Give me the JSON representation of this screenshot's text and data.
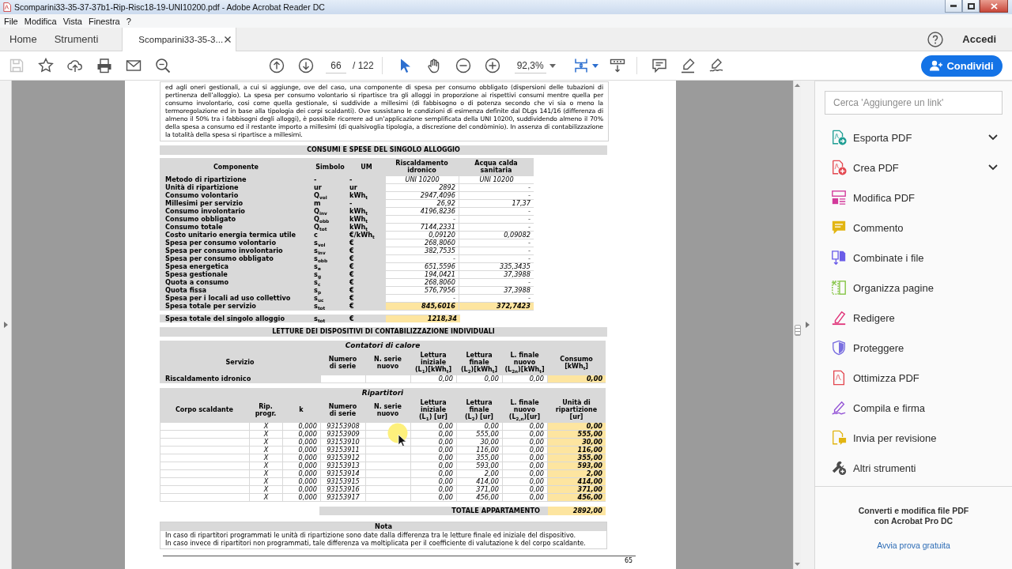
{
  "window": {
    "title": "Scomparini33-35-37-37b1-Rip-Risc18-19-UNI10200.pdf - Adobe Acrobat Reader DC"
  },
  "menu": [
    "File",
    "Modifica",
    "Vista",
    "Finestra",
    "?"
  ],
  "tabs": [
    {
      "kind": "nav",
      "label": "Home",
      "selected": false
    },
    {
      "kind": "nav",
      "label": "Strumenti",
      "selected": false
    },
    {
      "kind": "document",
      "label": "Scomparini33-35-3...",
      "selected": true
    }
  ],
  "account": {
    "label": "Accedi"
  },
  "toolbar": {
    "save": {
      "disabled": true
    },
    "page": "66",
    "page_total": "/ 122",
    "pointer_tools": [
      {
        "selected": true
      },
      {
        "selected": false
      }
    ],
    "zoom": "92,3%",
    "share": "Condividi"
  },
  "document": {
    "intro": "ed agli oneri gestionali, a cui si aggiunge, ove del caso, una componente di spesa per consumo obbligato (dispersioni delle tubazioni di pertinenza dell’alloggio). La spesa per consumo volontario si ripartisce tra gli alloggi in proporzione ai rispettivi consumi mentre quella per consumo involontario, cosi come quella gestionale, si suddivide a millesimi (di fabbisogno o di potenza secondo che vi sia o meno la termoregolazione ed in base alla tipologia dei corpi scaldanti). Ove sussistano le condizioni di esimenza definite dal DLgs 141/16 (differenza di almeno il 50% tra i fabbisogni degli alloggi), è possibile ricorrere ad un’applicazione semplificata della UNI 10200, suddividendo almeno il 70% della spesa a consumo ed il restante importo a millesimi (di qualsivoglia tipologia, a discrezione del condòminio). In assenza di contabilizzazione la totalità della spesa si ripartisce a millesimi.",
    "consumi": {
      "title": "CONSUMI E SPESE DEL SINGOLO ALLOGGIO",
      "columns": [
        "Componente",
        "Simbolo",
        "UM",
        "Riscaldamento\nidronico",
        "Acqua calda\nsanitaria"
      ],
      "rows": [
        {
          "kind": "text",
          "label": "Metodo di ripartizione",
          "symbol": "-",
          "unit": "-",
          "heating": "UNI 10200",
          "water": "UNI 10200"
        },
        {
          "kind": "number",
          "label": "Unità di ripartizione",
          "symbol": "ur",
          "unit": "ur",
          "heating": "2892",
          "water": "-"
        },
        {
          "kind": "number",
          "label": "Consumo volontario",
          "symbol": "Q$_{vol}$",
          "unit": "kWh$_{t}$",
          "heating": "2947,4096",
          "water": "-"
        },
        {
          "kind": "number",
          "label": "Millesimi per servizio",
          "symbol": "m",
          "unit": "-",
          "heating": "26,92",
          "water": "17,37"
        },
        {
          "kind": "number",
          "label": "Consumo involontario",
          "symbol": "Q$_{inv}$",
          "unit": "kWh$_{t}$",
          "heating": "4196,8236",
          "water": "-"
        },
        {
          "kind": "number",
          "label": "Consumo obbligato",
          "symbol": "Q$_{obb}$",
          "unit": "kWh$_{t}$",
          "heating": "-",
          "water": "-"
        },
        {
          "kind": "number",
          "label": "Consumo totale",
          "symbol": "Q$_{tot}$",
          "unit": "kWh$_{t}$",
          "heating": "7144,2331",
          "water": "-"
        },
        {
          "kind": "number",
          "label": "Costo unitario energia termica utile",
          "symbol": "c",
          "unit": "€/kWh$_{t}$",
          "heating": "0,09120",
          "water": "0,09082"
        },
        {
          "kind": "number",
          "label": "Spesa per consumo volontario",
          "symbol": "s$_{vol}$",
          "unit": "€",
          "heating": "268,8060",
          "water": "-"
        },
        {
          "kind": "number",
          "label": "Spesa per consumo involontario",
          "symbol": "s$_{inv}$",
          "unit": "€",
          "heating": "382,7535",
          "water": "-"
        },
        {
          "kind": "number",
          "label": "Spesa per consumo obbligato",
          "symbol": "s$_{obb}$",
          "unit": "€",
          "heating": "-",
          "water": "-"
        },
        {
          "kind": "number",
          "label": "Spesa energetica",
          "symbol": "s$_{e}$",
          "unit": "€",
          "heating": "651,5596",
          "water": "335,3435"
        },
        {
          "kind": "number",
          "label": "Spesa gestionale",
          "symbol": "s$_{g}$",
          "unit": "€",
          "heating": "194,0421",
          "water": "37,3988"
        },
        {
          "kind": "number",
          "label": "Quota a consumo",
          "symbol": "s$_{c}$",
          "unit": "€",
          "heating": "268,8060",
          "water": "-"
        },
        {
          "kind": "number",
          "label": "Quota fissa",
          "symbol": "s$_{p}$",
          "unit": "€",
          "heating": "576,7956",
          "water": "37,3988"
        },
        {
          "kind": "number",
          "label": "Spesa per i locali ad uso collettivo",
          "symbol": "s$_{uc}$",
          "unit": "€",
          "heating": "-",
          "water": "-"
        },
        {
          "kind": "total",
          "label": "Spesa totale per servizio",
          "symbol": "s$_{tot}$",
          "unit": "€",
          "heating": "845,6016",
          "water": "372,7423"
        }
      ],
      "grand_total": {
        "label": "Spesa totale del singolo alloggio",
        "symbol": "s$_{tot}$",
        "unit": "€",
        "value": "1218,34"
      }
    },
    "letture": {
      "title": "LETTURE DEI DISPOSITIVI DI CONTABILIZZAZIONE INDIVIDUALI",
      "contatori": {
        "title": "Contatori di calore",
        "columns": [
          "Servizio",
          "Numero\ndi serie",
          "N. serie\nnuovo",
          "Lettura\niniziale\n(L$_{1}$)[kWh$_{t}$]",
          "Lettura\nfinale\n(L$_{2}$)[kWh$_{t}$]",
          "L. finale\nnuovo\n(L$_{2n}$)[kWh$_{t}$]",
          "Consumo\n[kWh$_{t}$]"
        ],
        "rows": [
          {
            "service": "Riscaldamento idronico",
            "initial": "0,00",
            "final": "0,00",
            "final_new": "0,00",
            "consumption": "0,00"
          }
        ]
      },
      "ripartitori": {
        "title": "Ripartitori",
        "columns": [
          "Corpo scaldante",
          "Rip.\nprogr.",
          "k",
          "Numero\ndi serie",
          "N. serie\nnuovo",
          "Lettura\niniziale\n(L$_{1}$) [ur]",
          "Lettura\nfinale\n(L$_{2}$) [ur]",
          "L. finale\nnuovo\n(L$_{2,n}$)[ur]",
          "Unità di\nripartizione\n[ur]"
        ],
        "rows": [
          {
            "rip_progr": "X",
            "k": "0,000",
            "serial": "93153908",
            "initial": "0,00",
            "final": "0,00",
            "final_new": "0,00",
            "units": "0,00"
          },
          {
            "rip_progr": "X",
            "k": "0,000",
            "serial": "93153909",
            "initial": "0,00",
            "final": "555,00",
            "final_new": "0,00",
            "units": "555,00"
          },
          {
            "rip_progr": "X",
            "k": "0,000",
            "serial": "93153910",
            "initial": "0,00",
            "final": "30,00",
            "final_new": "0,00",
            "units": "30,00"
          },
          {
            "rip_progr": "X",
            "k": "0,000",
            "serial": "93153911",
            "initial": "0,00",
            "final": "116,00",
            "final_new": "0,00",
            "units": "116,00"
          },
          {
            "rip_progr": "X",
            "k": "0,000",
            "serial": "93153912",
            "initial": "0,00",
            "final": "355,00",
            "final_new": "0,00",
            "units": "355,00"
          },
          {
            "rip_progr": "X",
            "k": "0,000",
            "serial": "93153913",
            "initial": "0,00",
            "final": "593,00",
            "final_new": "0,00",
            "units": "593,00"
          },
          {
            "rip_progr": "X",
            "k": "0,000",
            "serial": "93153914",
            "initial": "0,00",
            "final": "2,00",
            "final_new": "0,00",
            "units": "2,00"
          },
          {
            "rip_progr": "X",
            "k": "0,000",
            "serial": "93153915",
            "initial": "0,00",
            "final": "414,00",
            "final_new": "0,00",
            "units": "414,00"
          },
          {
            "rip_progr": "X",
            "k": "0,000",
            "serial": "93153916",
            "initial": "0,00",
            "final": "371,00",
            "final_new": "0,00",
            "units": "371,00"
          },
          {
            "rip_progr": "X",
            "k": "0,000",
            "serial": "93153917",
            "initial": "0,00",
            "final": "456,00",
            "final_new": "0,00",
            "units": "456,00"
          }
        ],
        "total": {
          "label": "TOTALE APPARTAMENTO",
          "value": "2892,00"
        }
      }
    },
    "note": {
      "title": "Nota",
      "lines": [
        "In caso di ripartitori programmati le unità di ripartizione sono date dalla differenza tra le letture finale ed iniziale del dispositivo.",
        "In caso invece di ripartitori non programmati, tale differenza va moltiplicata per il coefficiente di valutazione k del corpo scaldante."
      ]
    },
    "page_number": "65"
  },
  "tools_pane": {
    "search": {
      "placeholder": "Cerca 'Aggiungere un link'"
    },
    "tools": [
      {
        "label": "Esporta PDF",
        "dropdown": true
      },
      {
        "label": "Crea PDF",
        "dropdown": true
      },
      {
        "label": "Modifica PDF",
        "dropdown": false
      },
      {
        "label": "Commento",
        "dropdown": false
      },
      {
        "label": "Combinate i file",
        "dropdown": false
      },
      {
        "label": "Organizza pagine",
        "dropdown": false
      },
      {
        "label": "Redigere",
        "dropdown": false
      },
      {
        "label": "Proteggere",
        "dropdown": false
      },
      {
        "label": "Ottimizza PDF",
        "dropdown": false
      },
      {
        "label": "Compila e firma",
        "dropdown": false
      },
      {
        "label": "Invia per revisione",
        "dropdown": false
      },
      {
        "label": "Altri strumenti",
        "dropdown": false
      }
    ],
    "promo": {
      "text": "Converti e modifica file PDF con Acrobat Pro DC",
      "link": "Avvia prova gratuita"
    }
  }
}
